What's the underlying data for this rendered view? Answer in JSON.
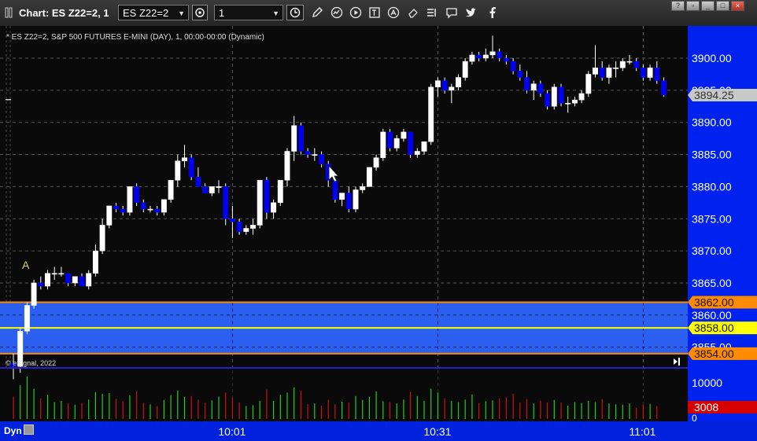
{
  "window": {
    "title": "Chart: ES Z22=2, 1",
    "symbol_value": "ES Z22=2",
    "interval_value": "1",
    "buttons": [
      "?",
      "▫",
      "_",
      "□",
      "×"
    ]
  },
  "chart": {
    "header": "* ES Z22=2, S&P 500 FUTURES E-MINI (DAY), 1, 00:00-00:00 (Dynamic)",
    "copyright": "© eSignal, 2022",
    "marker_letter": "A",
    "price_ticks": [
      "3900.00",
      "3895.00",
      "3890.00",
      "3885.00",
      "3880.00",
      "3875.00",
      "3870.00",
      "3865.00",
      "3860.00",
      "3855.00"
    ],
    "price_tick_values": [
      3900,
      3895,
      3890,
      3885,
      3880,
      3875,
      3870,
      3865,
      3860,
      3855
    ],
    "price_range": [
      3853,
      3905
    ],
    "last_price": "3894.25",
    "last_price_value": 3894.25,
    "zone_high": "3862.00",
    "zone_high_value": 3862,
    "zone_mid": "3858.00",
    "zone_mid_value": 3858,
    "zone_low": "3854.00",
    "zone_low_value": 3854,
    "volume_tick": "10000",
    "volume_tick_zero": "0",
    "volume_last": "3008",
    "time_labels": [
      "10:01",
      "10:31",
      "11:01"
    ],
    "time_label_bars": [
      32,
      62,
      92
    ],
    "colors": {
      "up_candle": "#ffffff",
      "down_candle": "#0000ee",
      "zone_fill": "#2a5ff0",
      "zone_edge": "#ff8c00",
      "zone_mid_line": "#ffff00",
      "axis_bg": "#0022ee",
      "last_price_bg": "#c8c8c8",
      "volume_up": "#22cc22",
      "volume_down": "#cc1111",
      "volume_last_bg": "#d40000"
    }
  },
  "chart_data": {
    "type": "candlestick",
    "bars": [
      [
        3852.5,
        3854,
        3850,
        3852
      ],
      [
        3852,
        3858,
        3851,
        3857.5
      ],
      [
        3857.5,
        3862,
        3857,
        3861.5
      ],
      [
        3861.5,
        3865.5,
        3861,
        3865
      ],
      [
        3865,
        3866,
        3864,
        3864.5
      ],
      [
        3864.5,
        3867,
        3864,
        3866.5
      ],
      [
        3866.5,
        3867.5,
        3865.5,
        3866.5
      ],
      [
        3866.5,
        3867.5,
        3866,
        3866.5
      ],
      [
        3866.5,
        3866.5,
        3864.5,
        3865
      ],
      [
        3865,
        3866,
        3864.5,
        3866
      ],
      [
        3866,
        3866.5,
        3864.5,
        3864.5
      ],
      [
        3864.5,
        3867,
        3864,
        3866.5
      ],
      [
        3866.5,
        3871,
        3866,
        3870
      ],
      [
        3870,
        3875,
        3869.5,
        3874
      ],
      [
        3874,
        3877,
        3873.5,
        3877
      ],
      [
        3877,
        3877.5,
        3876,
        3876.5
      ],
      [
        3876.5,
        3877,
        3875.5,
        3876
      ],
      [
        3876,
        3880,
        3875.5,
        3880
      ],
      [
        3880,
        3880.5,
        3877,
        3877.5
      ],
      [
        3877.5,
        3878,
        3876,
        3876.5
      ],
      [
        3876.5,
        3877,
        3876,
        3876.5
      ],
      [
        3876.5,
        3877,
        3875.5,
        3876
      ],
      [
        3876,
        3878,
        3875.5,
        3878
      ],
      [
        3878,
        3881,
        3877.5,
        3881
      ],
      [
        3881,
        3885,
        3880,
        3884
      ],
      [
        3884,
        3886.5,
        3883,
        3884.5
      ],
      [
        3884.5,
        3885,
        3881,
        3881.5
      ],
      [
        3881.5,
        3883,
        3880,
        3880
      ],
      [
        3880,
        3880.5,
        3879,
        3879
      ],
      [
        3879,
        3880,
        3878.5,
        3880
      ],
      [
        3880,
        3881,
        3879,
        3880
      ],
      [
        3880,
        3880.5,
        3874,
        3875
      ],
      [
        3875,
        3877,
        3872,
        3874.5
      ],
      [
        3874.5,
        3875,
        3872.5,
        3873
      ],
      [
        3873,
        3874,
        3872.5,
        3873.5
      ],
      [
        3873.5,
        3875,
        3872.5,
        3874
      ],
      [
        3874,
        3881,
        3873.5,
        3881
      ],
      [
        3881,
        3881.5,
        3875,
        3876
      ],
      [
        3876,
        3878,
        3875,
        3877.5
      ],
      [
        3877.5,
        3881,
        3877,
        3881
      ],
      [
        3881,
        3886,
        3880,
        3885.5
      ],
      [
        3885.5,
        3891,
        3884,
        3889.5
      ],
      [
        3889.5,
        3890,
        3885,
        3885.5
      ],
      [
        3885.5,
        3886,
        3884.5,
        3885
      ],
      [
        3885,
        3886,
        3884,
        3885
      ],
      [
        3885,
        3885.5,
        3883,
        3883.5
      ],
      [
        3883.5,
        3884,
        3880,
        3881
      ],
      [
        3881,
        3881.5,
        3877.5,
        3878
      ],
      [
        3878,
        3879,
        3877,
        3879
      ],
      [
        3879,
        3880,
        3876,
        3876.5
      ],
      [
        3876.5,
        3880,
        3876,
        3879.5
      ],
      [
        3879.5,
        3880.5,
        3879,
        3880
      ],
      [
        3880,
        3883,
        3880,
        3883
      ],
      [
        3883,
        3885,
        3882.5,
        3884.5
      ],
      [
        3884.5,
        3889,
        3884,
        3888.5
      ],
      [
        3888.5,
        3889,
        3885.5,
        3886
      ],
      [
        3886,
        3888,
        3885.5,
        3887.5
      ],
      [
        3887.5,
        3889,
        3887,
        3888.5
      ],
      [
        3888.5,
        3888.5,
        3884.5,
        3885
      ],
      [
        3885,
        3886,
        3884.5,
        3885.5
      ],
      [
        3885.5,
        3887,
        3885,
        3887
      ],
      [
        3887,
        3896,
        3886.5,
        3895.5
      ],
      [
        3895.5,
        3897,
        3894,
        3896.5
      ],
      [
        3896.5,
        3897,
        3894.5,
        3895
      ],
      [
        3895,
        3896,
        3893,
        3895.5
      ],
      [
        3895.5,
        3897.5,
        3895,
        3897
      ],
      [
        3897,
        3900,
        3896.5,
        3899.5
      ],
      [
        3899.5,
        3901,
        3899,
        3900.5
      ],
      [
        3900.5,
        3901,
        3899.5,
        3900
      ],
      [
        3900,
        3901.5,
        3899.5,
        3900.5
      ],
      [
        3900.5,
        3903.5,
        3900,
        3901
      ],
      [
        3901,
        3901.5,
        3899.5,
        3900
      ],
      [
        3900,
        3900.5,
        3899,
        3899.5
      ],
      [
        3899.5,
        3900,
        3897.5,
        3898
      ],
      [
        3898,
        3899,
        3896.5,
        3897
      ],
      [
        3897,
        3898,
        3894.5,
        3895
      ],
      [
        3895,
        3896.5,
        3893.5,
        3896
      ],
      [
        3896,
        3896.5,
        3894,
        3894.5
      ],
      [
        3894.5,
        3895,
        3892,
        3892.5
      ],
      [
        3892.5,
        3896,
        3892,
        3895.5
      ],
      [
        3895.5,
        3896,
        3892.5,
        3893
      ],
      [
        3893,
        3894,
        3891.5,
        3893
      ],
      [
        3893,
        3894,
        3892.5,
        3893.5
      ],
      [
        3893.5,
        3895,
        3893,
        3894.5
      ],
      [
        3894.5,
        3898,
        3894,
        3897.5
      ],
      [
        3897.5,
        3902,
        3897,
        3898.5
      ],
      [
        3898.5,
        3899.5,
        3896.5,
        3897
      ],
      [
        3897,
        3899,
        3896,
        3898.5
      ],
      [
        3898.5,
        3899.5,
        3897,
        3898.5
      ],
      [
        3898.5,
        3900,
        3898,
        3899.5
      ],
      [
        3899.5,
        3900.5,
        3899,
        3899.5
      ],
      [
        3899.5,
        3900,
        3898,
        3898.5
      ],
      [
        3898.5,
        3899,
        3896.5,
        3897
      ],
      [
        3897,
        3899,
        3896.5,
        3898.5
      ],
      [
        3898.5,
        3899.5,
        3896,
        3896.5
      ],
      [
        3896.5,
        3897,
        3894,
        3894.25
      ]
    ],
    "volume": [
      5200,
      7800,
      9800,
      7000,
      4800,
      5600,
      3900,
      4200,
      3600,
      3300,
      3700,
      4500,
      6200,
      5800,
      6000,
      4700,
      4100,
      5500,
      6400,
      3700,
      3400,
      3000,
      4400,
      5500,
      6600,
      5100,
      5300,
      4500,
      3700,
      4300,
      5200,
      6100,
      4900,
      3800,
      3000,
      3200,
      4200,
      6800,
      4200,
      5600,
      6100,
      7300,
      6600,
      3400,
      3600,
      3100,
      4400,
      3400,
      4000,
      3800,
      5300,
      4400,
      5100,
      6400,
      4100,
      3900,
      3600,
      4500,
      6300,
      5300,
      4200,
      7000,
      6100,
      4800,
      4200,
      3900,
      4500,
      5700,
      3700,
      4100,
      4300,
      4800,
      5000,
      5800,
      3800,
      4600,
      3600,
      4200,
      3800,
      4400,
      3800,
      3100,
      3900,
      3700,
      4200,
      3900,
      4600,
      3600,
      3400,
      3300,
      3600,
      2600,
      3300,
      3500,
      3008
    ],
    "ylim": [
      3853,
      3905
    ],
    "series_colors": {
      "up": "#ffffff",
      "down": "#0000ee"
    }
  }
}
